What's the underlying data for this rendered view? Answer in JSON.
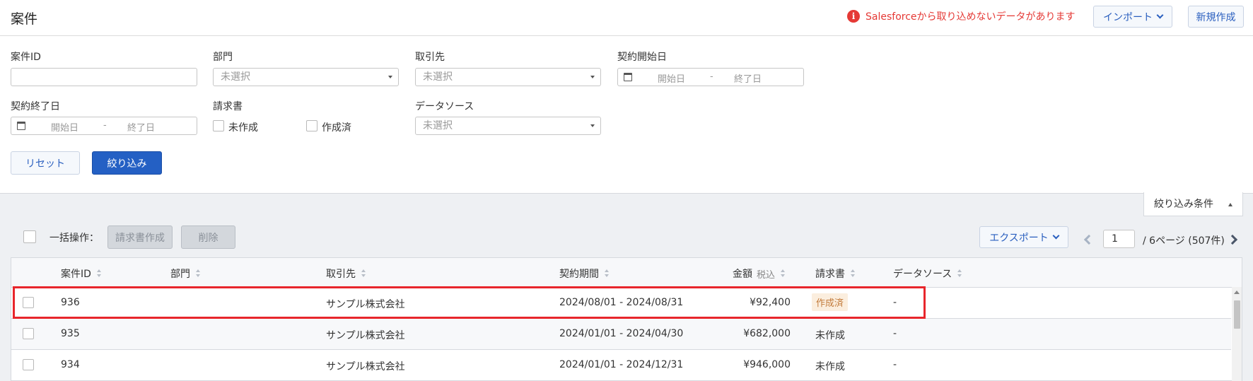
{
  "header": {
    "title": "案件",
    "warning_text": "Salesforceから取り込めないデータがあります",
    "import_label": "インポート",
    "new_label": "新規作成"
  },
  "filters": {
    "case_id_label": "案件ID",
    "case_id_value": "",
    "dept_label": "部門",
    "dept_placeholder": "未選択",
    "client_label": "取引先",
    "client_placeholder": "未選択",
    "start_label": "契約開始日",
    "end_label": "契約終了日",
    "date_start_placeholder": "開始日",
    "date_end_placeholder": "終了日",
    "date_sep": "-",
    "invoice_label": "請求書",
    "invoice_not_created": "未作成",
    "invoice_created": "作成済",
    "datasource_label": "データソース",
    "datasource_placeholder": "未選択",
    "reset_label": "リセット",
    "apply_label": "絞り込み"
  },
  "list": {
    "conditions_tab": "絞り込み条件",
    "bulk_label": "一括操作：",
    "bulk_invoice": "請求書作成",
    "bulk_delete": "削除",
    "export_label": "エクスポート",
    "page_value": "1",
    "page_info": "/ 6ページ (507件)"
  },
  "table": {
    "headers": {
      "case_id": "案件ID",
      "dept": "部門",
      "client": "取引先",
      "period": "契約期間",
      "amount": "金額",
      "amount_sub": "税込",
      "invoice": "請求書",
      "datasource": "データソース"
    },
    "rows": [
      {
        "id": "936",
        "dept": "",
        "client": "サンプル株式会社",
        "period": "2024/08/01 - 2024/08/31",
        "amount": "¥92,400",
        "invoice": "作成済",
        "datasource": "-"
      },
      {
        "id": "935",
        "dept": "",
        "client": "サンプル株式会社",
        "period": "2024/01/01 - 2024/04/30",
        "amount": "¥682,000",
        "invoice": "未作成",
        "datasource": "-"
      },
      {
        "id": "934",
        "dept": "",
        "client": "サンプル株式会社",
        "period": "2024/01/01 - 2024/12/31",
        "amount": "¥946,000",
        "invoice": "未作成",
        "datasource": "-"
      }
    ]
  },
  "colors": {
    "accent": "#2460c4",
    "warning": "#e53935",
    "highlight": "#e8262c"
  }
}
